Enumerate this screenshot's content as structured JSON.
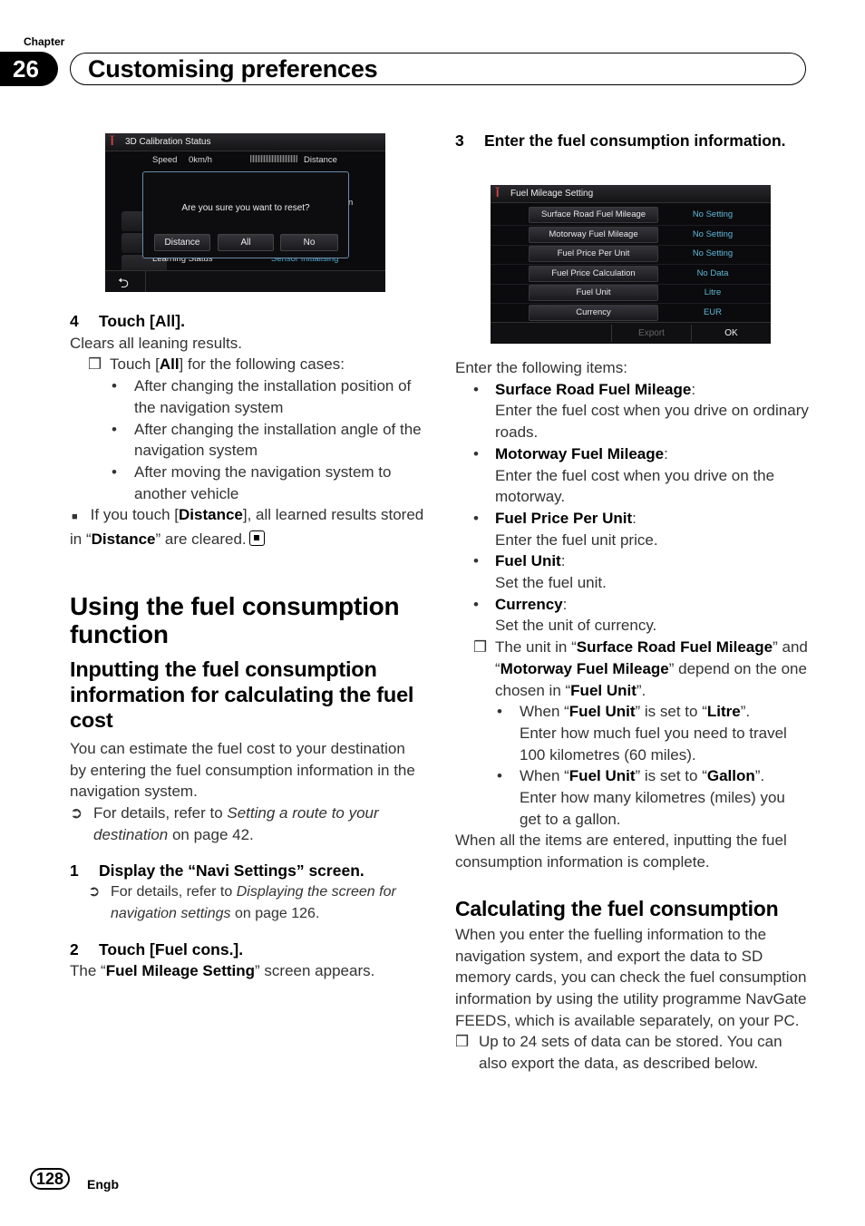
{
  "header": {
    "chapter_label": "Chapter",
    "chapter_number": "26",
    "chapter_title": "Customising preferences"
  },
  "screen_calibration": {
    "title": "3D Calibration Status",
    "speed_label": "Speed",
    "speed_value": "0km/h",
    "distance_label": "Distance",
    "partial_label": "n",
    "learning_status_label": "Learning Status",
    "sensor_status": "Sensor Initialising",
    "dialog": {
      "message": "Are you sure you want to reset?",
      "buttons": [
        "Distance",
        "All",
        "No"
      ]
    },
    "back_icon": "back-arrow-icon"
  },
  "left": {
    "step4": {
      "num": "4",
      "text": "Touch [All]."
    },
    "clears": "Clears all leaning results.",
    "note_all": {
      "pre": "Touch [",
      "bold": "All",
      "post": "] for the following cases:"
    },
    "cases": [
      "After changing the installation position of the navigation system",
      "After changing the installation angle of the navigation system",
      "After moving the navigation system to another vehicle"
    ],
    "distance_note": {
      "pre": "If you touch [",
      "bold1": "Distance",
      "mid": "], all learned results stored in “",
      "bold2": "Distance",
      "post": "” are cleared."
    },
    "h1": "Using the fuel consumption function",
    "h2": "Inputting the fuel consumption information for calculating the fuel cost",
    "intro": "You can estimate the fuel cost to your destination by entering the fuel consumption information in the navigation system.",
    "intro_ref": {
      "pre": "For details, refer to ",
      "italic": "Setting a route to your destination",
      "post": " on page 42."
    },
    "step1": {
      "num": "1",
      "text": "Display the “Navi Settings” screen."
    },
    "step1_ref": {
      "pre": "For details, refer to ",
      "italic": "Displaying the screen for navigation settings",
      "post": " on page 126."
    },
    "step2": {
      "num": "2",
      "text": "Touch [Fuel cons.]."
    },
    "step2_result": {
      "pre": "The “",
      "bold": "Fuel Mileage Setting",
      "post": "” screen appears."
    }
  },
  "screen_fuel": {
    "title": "Fuel Mileage Setting",
    "rows": [
      {
        "label": "Surface Road Fuel Mileage",
        "value": "No Setting"
      },
      {
        "label": "Motorway Fuel Mileage",
        "value": "No Setting"
      },
      {
        "label": "Fuel Price Per Unit",
        "value": "No Setting"
      },
      {
        "label": "Fuel Price Calculation",
        "value": "No Data"
      },
      {
        "label": "Fuel Unit",
        "value": "Litre"
      },
      {
        "label": "Currency",
        "value": "EUR"
      }
    ],
    "export_label": "Export",
    "ok_label": "OK",
    "value_color": "#5fb7d8"
  },
  "right": {
    "step3": {
      "num": "3",
      "text": "Enter the fuel consumption information."
    },
    "enter_items": "Enter the following items:",
    "items": [
      {
        "name": "Surface Road Fuel Mileage",
        "desc": "Enter the fuel cost when you drive on ordinary roads."
      },
      {
        "name": "Motorway Fuel Mileage",
        "desc": "Enter the fuel cost when you drive on the motorway."
      },
      {
        "name": "Fuel Price Per Unit",
        "desc": "Enter the fuel unit price."
      },
      {
        "name": "Fuel Unit",
        "desc": "Set the fuel unit."
      },
      {
        "name": "Currency",
        "desc": "Set the unit of currency."
      }
    ],
    "unit_note": {
      "t1": "The unit in “",
      "b1": "Surface Road Fuel Mileage",
      "t2": "” and “",
      "b2": "Motorway Fuel Mileage",
      "t3": "” depend on the one chosen in “",
      "b3": "Fuel Unit",
      "t4": "”."
    },
    "unit_cases": [
      {
        "pre": "When “",
        "b1": "Fuel Unit",
        "mid": "” is set to “",
        "b2": "Litre",
        "post": "”.",
        "desc": "Enter how much fuel you need to travel 100 kilometres (60 miles)."
      },
      {
        "pre": "When “",
        "b1": "Fuel Unit",
        "mid": "” is set to “",
        "b2": "Gallon",
        "post": "”.",
        "desc": "Enter how many kilometres (miles) you get to a gallon."
      }
    ],
    "complete": "When all the items are entered, inputting the fuel consumption information is complete.",
    "h2": "Calculating the fuel consumption",
    "calc_body": "When you enter the fuelling information to the navigation system, and export the data to SD memory cards, you can check the fuel consumption information by using the utility programme NavGate FEEDS, which is available separately, on your PC.",
    "calc_note": "Up to 24 sets of data can be stored. You can also export the data, as described below."
  },
  "footer": {
    "page_number": "128",
    "language": "Engb"
  }
}
